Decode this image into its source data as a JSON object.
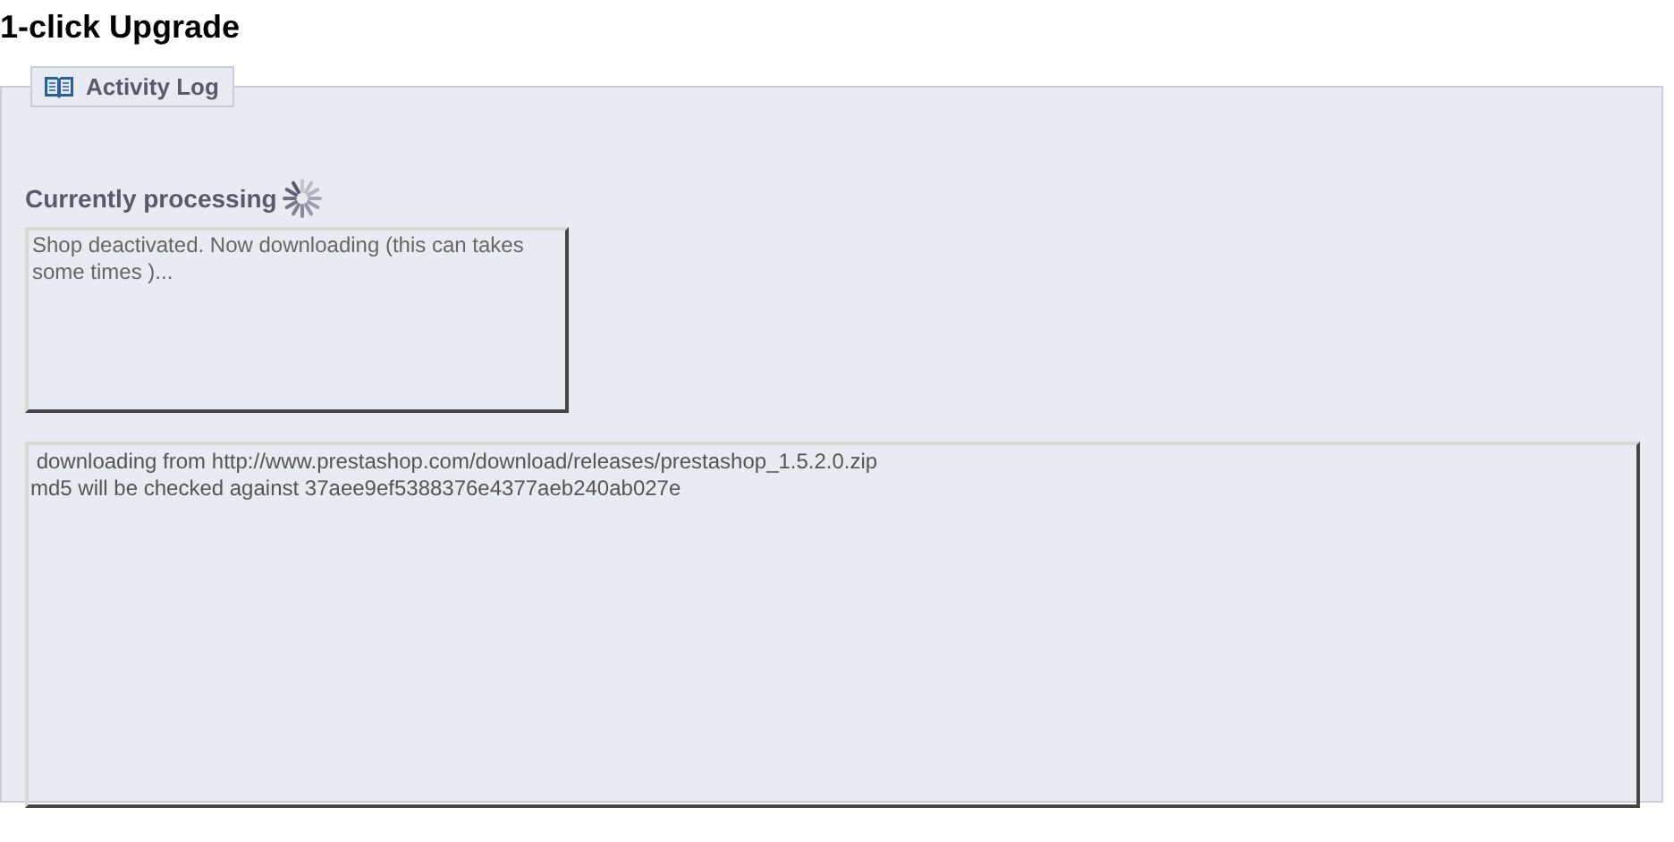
{
  "page_title": "1-click Upgrade",
  "panel": {
    "legend": "Activity Log",
    "processing_label": "Currently processing",
    "status_text": "Shop deactivated. Now downloading (this can takes some times )...",
    "log_lines": [
      " downloading from http://www.prestashop.com/download/releases/prestashop_1.5.2.0.zip",
      "md5 will be checked against 37aee9ef5388376e4377aeb240ab027e"
    ]
  }
}
